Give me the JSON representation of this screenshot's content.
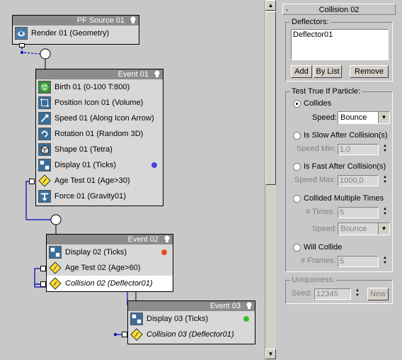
{
  "colors": {
    "canvas_bg": "#c8c8c8",
    "title_bar": "#8c8c8c",
    "wire": "#0000c0",
    "display01_dot": "#4444dd",
    "display02_dot": "#e05020",
    "display03_dot": "#30c030",
    "test_icon": "#ffe030"
  },
  "source": {
    "title": "PF Source 01",
    "operators": [
      {
        "label": "Render 01 (Geometry)",
        "icon": "render-icon"
      }
    ]
  },
  "event01": {
    "title": "Event 01",
    "operators": [
      {
        "label": "Birth 01 (0-100 T:800)",
        "icon": "birth-icon"
      },
      {
        "label": "Position Icon 01 (Volume)",
        "icon": "position-icon"
      },
      {
        "label": "Speed 01 (Along Icon Arrow)",
        "icon": "speed-icon"
      },
      {
        "label": "Rotation 01 (Random 3D)",
        "icon": "rotation-icon"
      },
      {
        "label": "Shape 01 (Tetra)",
        "icon": "shape-icon"
      },
      {
        "label": "Display 01 (Ticks)",
        "icon": "display-icon"
      },
      {
        "label": "Age Test 01 (Age>30)",
        "icon": "test-icon"
      },
      {
        "label": "Force 01 (Gravity01)",
        "icon": "force-icon"
      }
    ]
  },
  "event02": {
    "title": "Event 02",
    "operators": [
      {
        "label": "Display 02 (Ticks)",
        "icon": "display-icon"
      },
      {
        "label": "Age Test 02 (Age>60)",
        "icon": "test-icon"
      },
      {
        "label": "Collision 02 (Deflector01)",
        "icon": "test-icon"
      }
    ]
  },
  "event03": {
    "title": "Event 03",
    "operators": [
      {
        "label": "Display 03 (Ticks)",
        "icon": "display-icon"
      },
      {
        "label": "Collision 03 (Deflector01)",
        "icon": "test-icon"
      }
    ]
  },
  "panel": {
    "rollout_title": "Collision 02",
    "rollout_toggle": "-",
    "deflectors_label": "Deflectors:",
    "deflector_items": [
      "Deflector01"
    ],
    "add_label": "Add",
    "bylist_label": "By List",
    "remove_label": "Remove",
    "test_group_label": "Test True If Particle:",
    "collides_label": "Collides",
    "speed_label": "Speed:",
    "speed_value": "Bounce",
    "slow_label": "Is Slow After Collision(s)",
    "speed_min_label": "Speed Min:",
    "speed_min_value": "1,0",
    "fast_label": "Is Fast After Collision(s)",
    "speed_max_label": "Speed Max:",
    "speed_max_value": "1000,0",
    "multiple_label": "Collided Multiple Times",
    "times_label": "# Times:",
    "times_value": "5",
    "mult_speed_label": "Speed:",
    "mult_speed_value": "Bounce",
    "will_collide_label": "Will Collide",
    "frames_label": "# Frames:",
    "frames_value": "5",
    "uniqueness_label": "Uniqueness:",
    "seed_label": "Seed:",
    "seed_value": "12345",
    "new_label": "New"
  }
}
